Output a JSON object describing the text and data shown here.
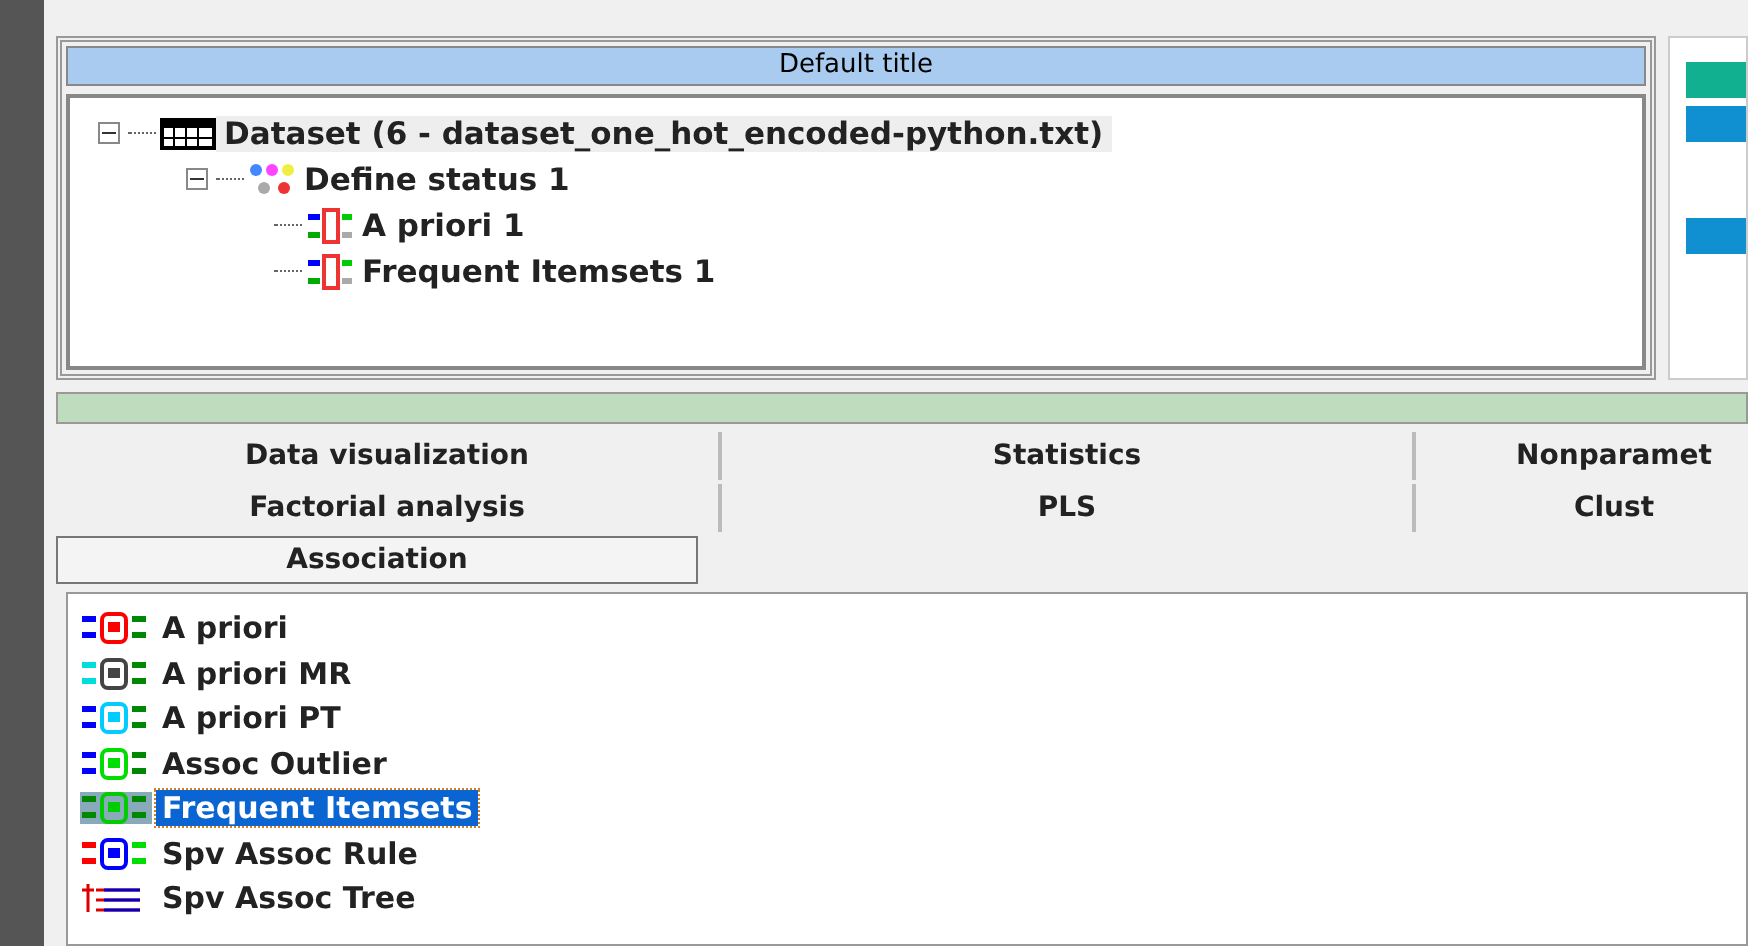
{
  "project_panel": {
    "title": "Default title",
    "tree": [
      {
        "label": "Dataset (6 - dataset_one_hot_encoded-python.txt)",
        "kind": "dataset",
        "expanded": true,
        "selected": true,
        "children": [
          {
            "label": "Define status 1",
            "kind": "status",
            "expanded": true,
            "selected": false,
            "children": [
              {
                "label": "A priori 1",
                "kind": "operator",
                "selected": false
              },
              {
                "label": "Frequent Itemsets 1",
                "kind": "operator",
                "selected": false
              }
            ]
          }
        ]
      }
    ]
  },
  "tabs": [
    {
      "label": "Data visualization",
      "selected": false
    },
    {
      "label": "Statistics",
      "selected": false
    },
    {
      "label": "Nonparamet",
      "selected": false
    },
    {
      "label": "Factorial analysis",
      "selected": false
    },
    {
      "label": "PLS",
      "selected": false
    },
    {
      "label": "Clust",
      "selected": false
    },
    {
      "label": "Association",
      "selected": true
    }
  ],
  "components": [
    {
      "label": "A priori",
      "kind": "rule",
      "selected": false
    },
    {
      "label": "A priori MR",
      "kind": "rule",
      "selected": false
    },
    {
      "label": "A priori PT",
      "kind": "rule",
      "selected": false
    },
    {
      "label": "Assoc Outlier",
      "kind": "rule",
      "selected": false
    },
    {
      "label": "Frequent Itemsets",
      "kind": "rule",
      "selected": true
    },
    {
      "label": "Spv Assoc Rule",
      "kind": "rule",
      "selected": false
    },
    {
      "label": "Spv Assoc Tree",
      "kind": "tree",
      "selected": false
    }
  ]
}
